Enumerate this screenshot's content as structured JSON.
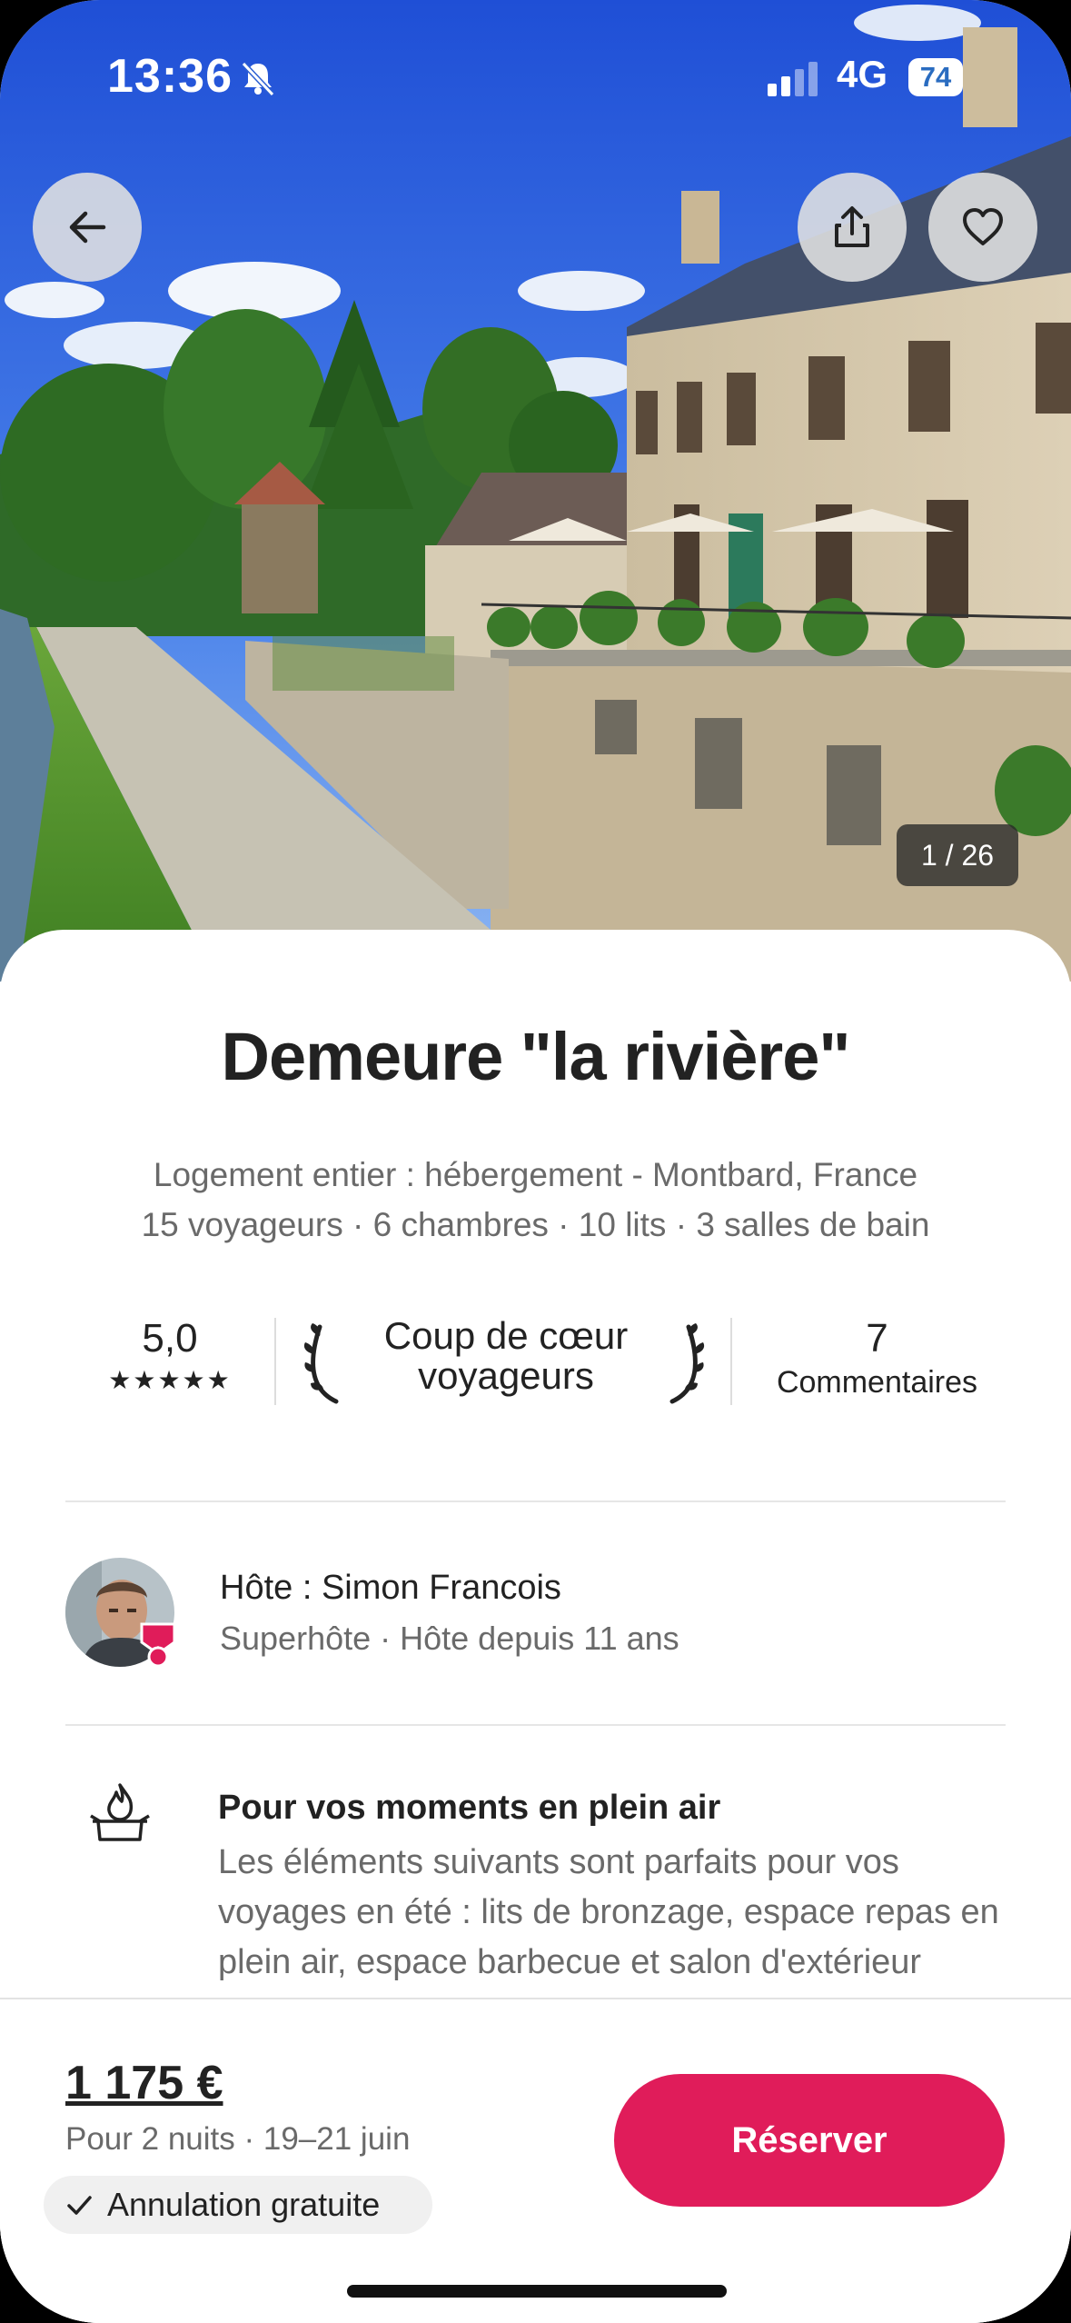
{
  "status_bar": {
    "time": "13:36",
    "network": "4G",
    "battery": "74"
  },
  "photo": {
    "counter": "1 / 26"
  },
  "listing": {
    "title": "Demeure \"la rivière\"",
    "type_location": "Logement entier : hébergement - Montbard, France",
    "capacity": "15 voyageurs · 6 chambres · 10 lits · 3 salles de bain"
  },
  "ratings": {
    "score": "5,0",
    "stars": "★★★★★",
    "guest_favorite_line1": "Coup de cœur",
    "guest_favorite_line2": "voyageurs",
    "reviews_count": "7",
    "reviews_label": "Commentaires"
  },
  "host": {
    "name": "Hôte : Simon Francois",
    "details": "Superhôte · Hôte depuis 11 ans"
  },
  "highlight": {
    "icon": "firepit-icon",
    "title": "Pour vos moments en plein air",
    "text": "Les éléments suivants sont parfaits pour vos voyages en été : lits de bronzage, espace repas en plein air, espace barbecue et salon d'extérieur"
  },
  "footer": {
    "price": "1 175 €",
    "dates": "Pour 2 nuits · 19–21 juin",
    "cancellation": "Annulation gratuite",
    "reserve_label": "Réserver"
  },
  "colors": {
    "accent": "#e01c5a",
    "text_primary": "#222222",
    "text_secondary": "#6a6a6a"
  }
}
